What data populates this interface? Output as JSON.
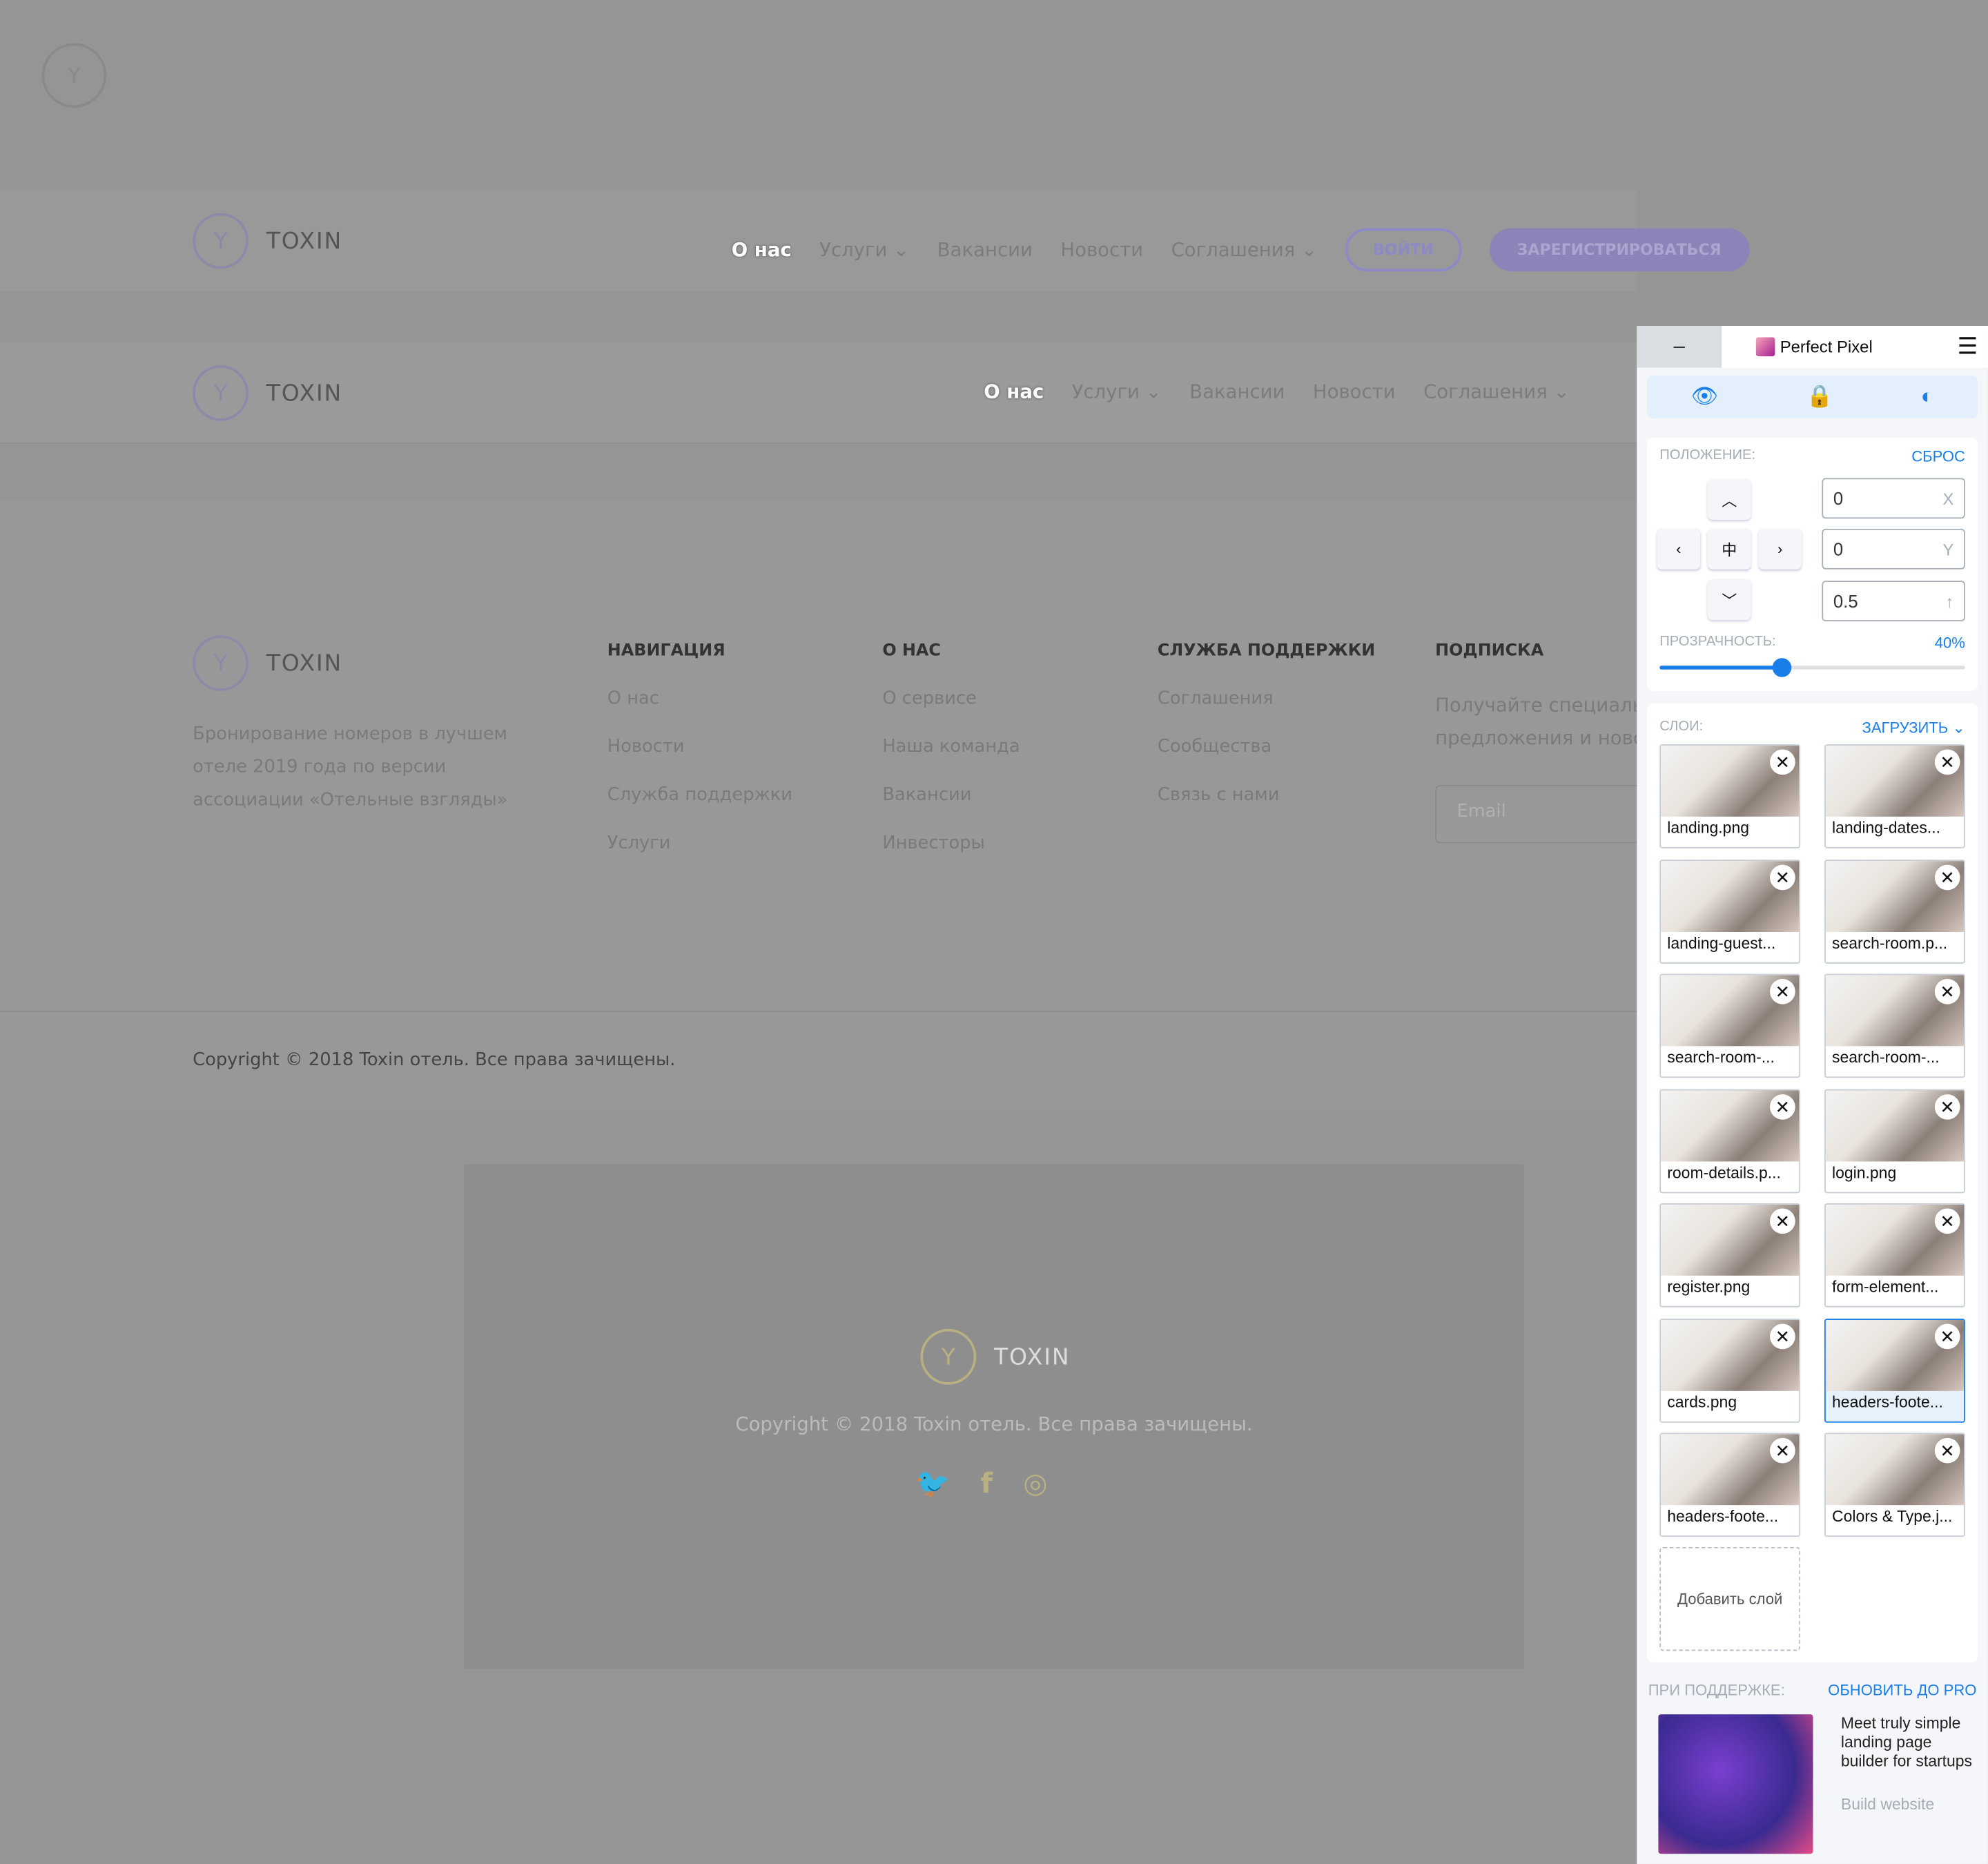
{
  "brand": "TOXIN",
  "header1": {
    "nav": [
      "О нас",
      "Услуги",
      "Вакансии",
      "Новости",
      "Соглашения"
    ],
    "login": "ВОЙТИ",
    "register": "ЗАРЕГИСТРИРОВАТЬСЯ"
  },
  "header2": {
    "nav": [
      "О нас",
      "Услуги",
      "Вакансии",
      "Новости",
      "Соглашения"
    ]
  },
  "footer": {
    "description": "Бронирование номеров в лучшем отеле 2019 года по версии ассоциации «Отельные взгляды»",
    "columns": [
      {
        "title": "НАВИГАЦИЯ",
        "items": [
          "О нас",
          "Новости",
          "Служба поддержки",
          "Услуги"
        ]
      },
      {
        "title": "О НАС",
        "items": [
          "О сервисе",
          "Наша команда",
          "Вакансии",
          "Инвесторы"
        ]
      },
      {
        "title": "СЛУЖБА ПОДДЕРЖКИ",
        "items": [
          "Соглашения",
          "Сообщества",
          "Связь с нами"
        ]
      }
    ],
    "subscribe_title": "ПОДПИСКА",
    "subscribe_text": "Получайте специальные предложения и новости",
    "email_placeholder": "Email",
    "copyright": "Copyright © 2018 Toxin отель. Все права зачищены."
  },
  "footer_small": {
    "copyright": "Copyright © 2018 Toxin отель. Все права зачищены.",
    "social": [
      "twitter-icon",
      "facebook-icon",
      "instagram-icon"
    ]
  },
  "panel": {
    "minimize": "–",
    "title": "Perfect Pixel",
    "position_label": "ПОЛОЖЕНИЕ:",
    "reset": "СБРОС",
    "x": "0",
    "x_label": "X",
    "y": "0",
    "y_label": "Y",
    "scale": "0.5",
    "scale_label": "↑",
    "opacity_label": "ПРОЗРАЧНОСТЬ:",
    "opacity": "40%",
    "opacity_value": 0.4,
    "layers_label": "СЛОИ:",
    "upload": "ЗАГРУЗИТЬ",
    "layers": [
      "landing.png",
      "landing-dates...",
      "landing-guest...",
      "search-room.p...",
      "search-room-...",
      "search-room-...",
      "room-details.p...",
      "login.png",
      "register.png",
      "form-element...",
      "cards.png",
      "headers-foote...",
      "headers-foote...",
      "Colors & Type.j..."
    ],
    "selected_layer": 11,
    "add_layer": "Добавить слой",
    "sponsor_label": "ПРИ ПОДДЕРЖКЕ:",
    "upgrade": "ОБНОВИТЬ ДО PRO",
    "ad_text": "Meet truly simple landing page builder for startups",
    "ad_link": "Build website",
    "accent": "#1a7ee8"
  }
}
